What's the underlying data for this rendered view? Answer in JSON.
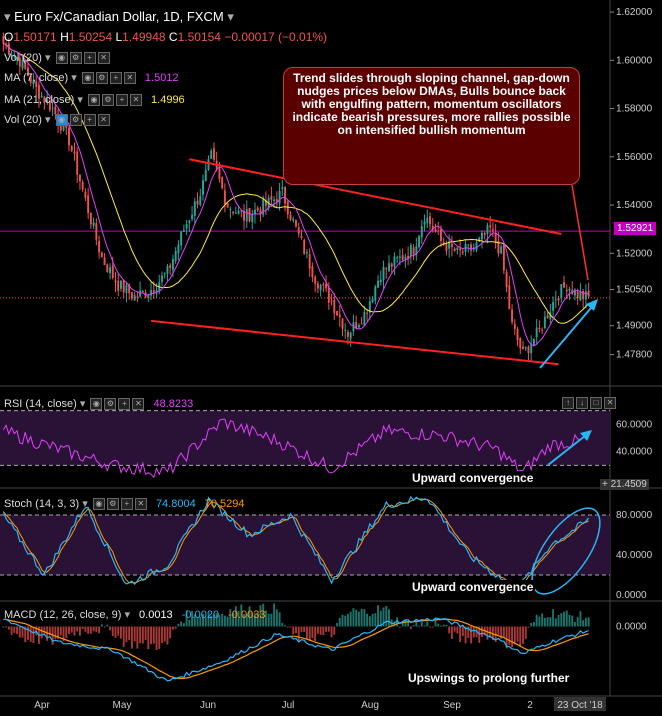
{
  "header": {
    "title": "Euro Fx/Canadian Dollar, 1D, FXCM",
    "ohlc": {
      "o_label": "O",
      "o": "1.50171",
      "h_label": "H",
      "h": "1.50254",
      "l_label": "L",
      "l": "1.49948",
      "c_label": "C",
      "c": "1.50154",
      "change": "−0.00017 (−0.01%)"
    },
    "indicators": [
      {
        "label": "Vol (20)",
        "value": ""
      },
      {
        "label": "MA (7, close)",
        "value": "1.5012"
      },
      {
        "label": "MA (21, close)",
        "value": "1.4996"
      },
      {
        "label": "Vol (20)",
        "value": ""
      }
    ]
  },
  "callout": {
    "text": "Trend slides through sloping channel, gap-down nudges prices below DMAs, Bulls bounce back with engulfing pattern, momentum oscillators indicate bearish pressures, more rallies possible on intensified bullish momentum"
  },
  "price_tag": "1.52921",
  "rsi_panel": {
    "label": "RSI (14, close)",
    "value": "48.8233",
    "annotation": "Upward convergence",
    "tag": "21.4509"
  },
  "stoch_panel": {
    "label": "Stoch (14, 3, 3)",
    "k_value": "74.8004",
    "d_value": "70.5294",
    "annotation": "Upward convergence"
  },
  "macd_panel": {
    "label": "MACD (12, 26, close, 9)",
    "v1": "0.0013",
    "v2": "-0.0020",
    "v3": "-0.0033",
    "annotation": "Upswings to prolong further"
  },
  "colors": {
    "up": "#26a69a",
    "down": "#ef5350",
    "ma7": "#e040fb",
    "ma21": "#ffeb3b",
    "trendline": "#ff2020",
    "arrow": "#29b6f6",
    "level": "#c000c0"
  },
  "chart_data": [
    {
      "type": "candlestick",
      "title": "Euro Fx/Canadian Dollar, 1D, FXCM",
      "x_ticks": [
        "Apr",
        "May",
        "Jun",
        "Jul",
        "Aug",
        "Sep",
        "2",
        "23 Oct '18"
      ],
      "y_ticks": [
        "1.62000",
        "1.60000",
        "1.58000",
        "1.56000",
        "1.54000",
        "1.52000",
        "1.50500",
        "1.49000",
        "1.47800"
      ],
      "ylim": [
        1.465,
        1.625
      ],
      "close_anchors": [
        [
          0,
          1.607
        ],
        [
          6,
          1.6
        ],
        [
          12,
          1.588
        ],
        [
          18,
          1.58
        ],
        [
          24,
          1.567
        ],
        [
          30,
          1.542
        ],
        [
          36,
          1.518
        ],
        [
          42,
          1.507
        ],
        [
          48,
          1.502
        ],
        [
          54,
          1.505
        ],
        [
          60,
          1.512
        ],
        [
          66,
          1.53
        ],
        [
          72,
          1.545
        ],
        [
          76,
          1.56
        ],
        [
          82,
          1.54
        ],
        [
          88,
          1.535
        ],
        [
          96,
          1.54
        ],
        [
          102,
          1.545
        ],
        [
          108,
          1.527
        ],
        [
          114,
          1.51
        ],
        [
          120,
          1.5
        ],
        [
          126,
          1.487
        ],
        [
          132,
          1.495
        ],
        [
          138,
          1.512
        ],
        [
          144,
          1.517
        ],
        [
          150,
          1.522
        ],
        [
          154,
          1.536
        ],
        [
          160,
          1.525
        ],
        [
          166,
          1.52
        ],
        [
          172,
          1.522
        ],
        [
          178,
          1.53
        ],
        [
          182,
          1.52
        ],
        [
          186,
          1.49
        ],
        [
          190,
          1.478
        ],
        [
          196,
          1.488
        ],
        [
          202,
          1.502
        ],
        [
          206,
          1.507
        ],
        [
          210,
          1.503
        ],
        [
          214,
          1.5015
        ]
      ],
      "channel_upper": [
        [
          1.559,
          0
        ],
        [
          1.528,
          1
        ]
      ],
      "channel_lower": [
        [
          1.492,
          0
        ],
        [
          1.474,
          1
        ]
      ],
      "level": 1.52921,
      "current": 1.50154
    },
    {
      "type": "line",
      "name": "RSI (14, close)",
      "y_ticks": [
        "60.0000",
        "40.0000"
      ],
      "ylim": [
        15,
        85
      ],
      "anchors": [
        [
          0,
          55
        ],
        [
          20,
          42
        ],
        [
          40,
          30
        ],
        [
          60,
          25
        ],
        [
          80,
          62
        ],
        [
          100,
          48
        ],
        [
          120,
          28
        ],
        [
          140,
          55
        ],
        [
          160,
          52
        ],
        [
          180,
          42
        ],
        [
          190,
          25
        ],
        [
          200,
          45
        ],
        [
          214,
          48.8
        ]
      ]
    },
    {
      "type": "line",
      "name": "Stoch (14, 3, 3)",
      "y_ticks": [
        "80.0000",
        "40.0000",
        "0.0000"
      ],
      "ylim": [
        -5,
        105
      ],
      "anchors": [
        [
          0,
          80
        ],
        [
          15,
          20
        ],
        [
          30,
          90
        ],
        [
          45,
          10
        ],
        [
          60,
          30
        ],
        [
          75,
          95
        ],
        [
          90,
          60
        ],
        [
          105,
          80
        ],
        [
          120,
          15
        ],
        [
          140,
          90
        ],
        [
          155,
          98
        ],
        [
          170,
          40
        ],
        [
          188,
          5
        ],
        [
          200,
          50
        ],
        [
          214,
          74.8
        ]
      ]
    },
    {
      "type": "bar",
      "name": "MACD (12, 26, close, 9)",
      "y_ticks": [
        "0.0000"
      ],
      "ylim": [
        -0.035,
        0.012
      ],
      "anchors": [
        [
          0,
          0.004
        ],
        [
          20,
          -0.008
        ],
        [
          40,
          -0.012
        ],
        [
          60,
          -0.028
        ],
        [
          80,
          -0.018
        ],
        [
          100,
          -0.004
        ],
        [
          120,
          -0.012
        ],
        [
          140,
          0.002
        ],
        [
          160,
          0.004
        ],
        [
          180,
          -0.006
        ],
        [
          190,
          -0.014
        ],
        [
          200,
          -0.008
        ],
        [
          214,
          -0.002
        ]
      ]
    }
  ]
}
